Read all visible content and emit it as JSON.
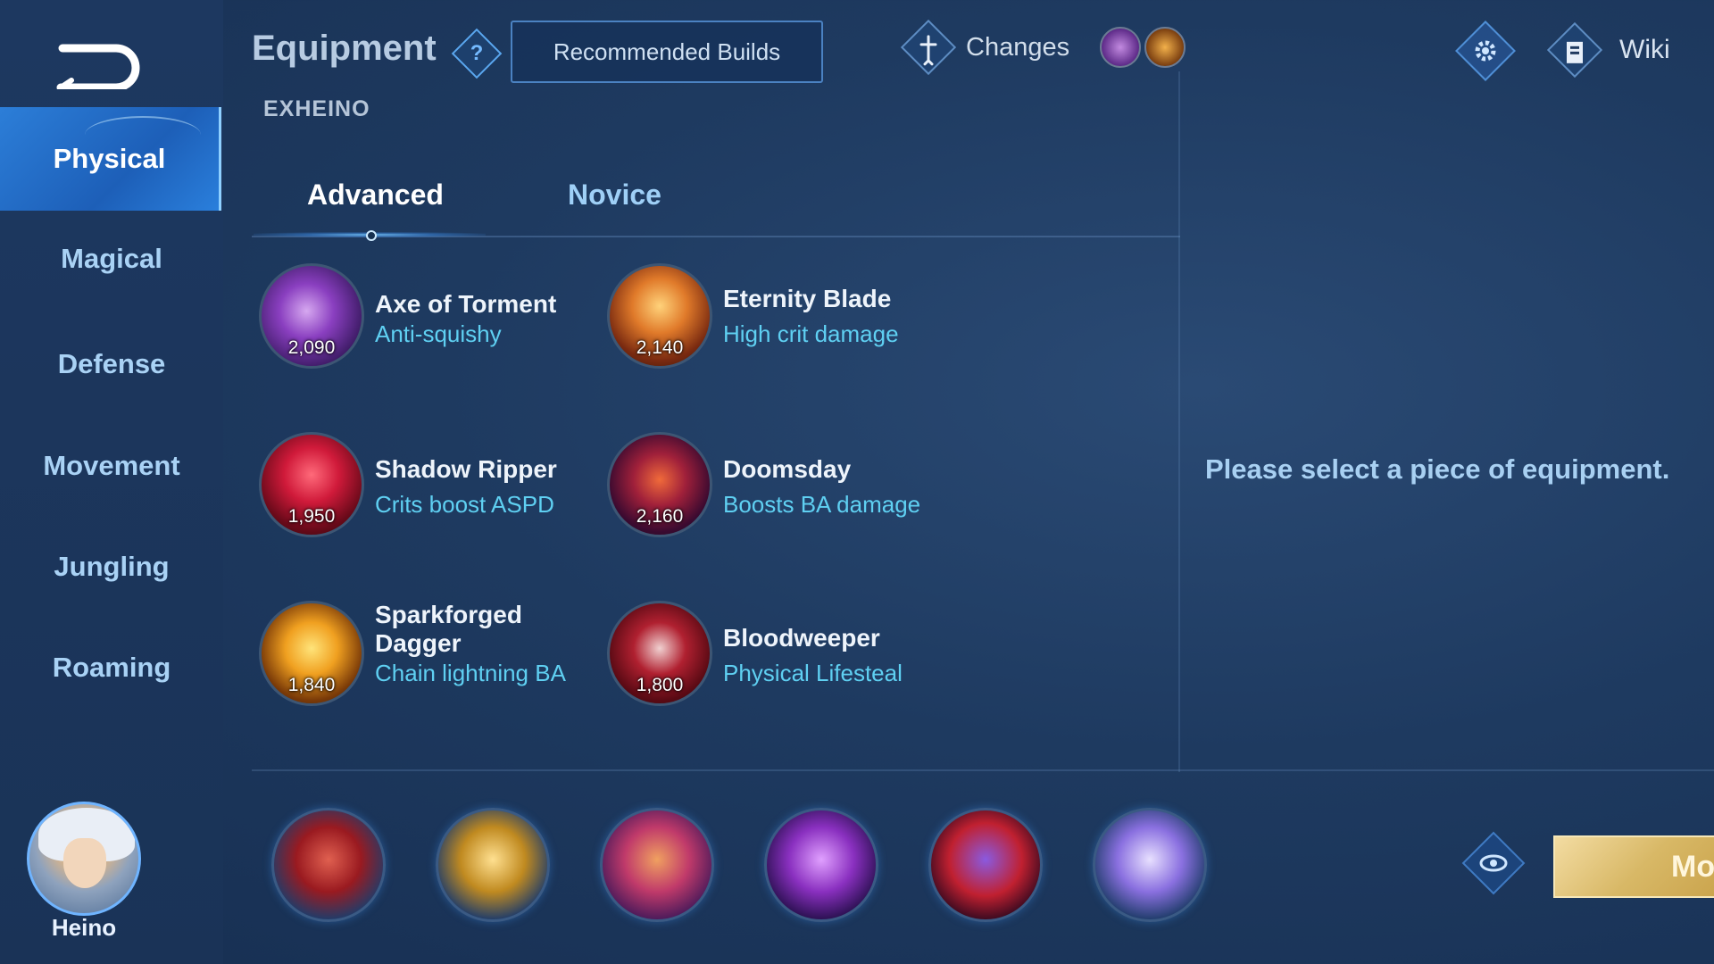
{
  "header": {
    "title": "Equipment",
    "help_glyph": "?",
    "recommended_builds_label": "Recommended Builds",
    "changes_label": "Changes",
    "wiki_label": "Wiki",
    "subtitle": "EXHEINO"
  },
  "sidebar": {
    "items": [
      {
        "label": "Physical",
        "active": true
      },
      {
        "label": "Magical",
        "active": false
      },
      {
        "label": "Defense",
        "active": false
      },
      {
        "label": "Movement",
        "active": false
      },
      {
        "label": "Jungling",
        "active": false
      },
      {
        "label": "Roaming",
        "active": false
      }
    ],
    "hero_name": "Heino"
  },
  "tabs": [
    {
      "label": "Advanced",
      "active": true
    },
    {
      "label": "Novice",
      "active": false
    }
  ],
  "items": [
    {
      "name": "Axe of Torment",
      "desc": "Anti-squishy",
      "price": "2,090"
    },
    {
      "name": "Eternity Blade",
      "desc": "High crit damage",
      "price": "2,140"
    },
    {
      "name": "Shadow Ripper",
      "desc": "Crits boost ASPD",
      "price": "1,950"
    },
    {
      "name": "Doomsday",
      "desc": "Boosts BA damage",
      "price": "2,160"
    },
    {
      "name": "Sparkforged Dagger",
      "desc": "Chain lightning BA",
      "price": "1,840"
    },
    {
      "name": "Bloodweeper",
      "desc": "Physical Lifesteal",
      "price": "1,800"
    }
  ],
  "detail_hint": "Please select a piece of equipment.",
  "more_button_label": "Mo",
  "colors": {
    "accent": "#2c7ed8",
    "description_cyan": "#5fd0f2",
    "gold_button": "#d8b866"
  }
}
